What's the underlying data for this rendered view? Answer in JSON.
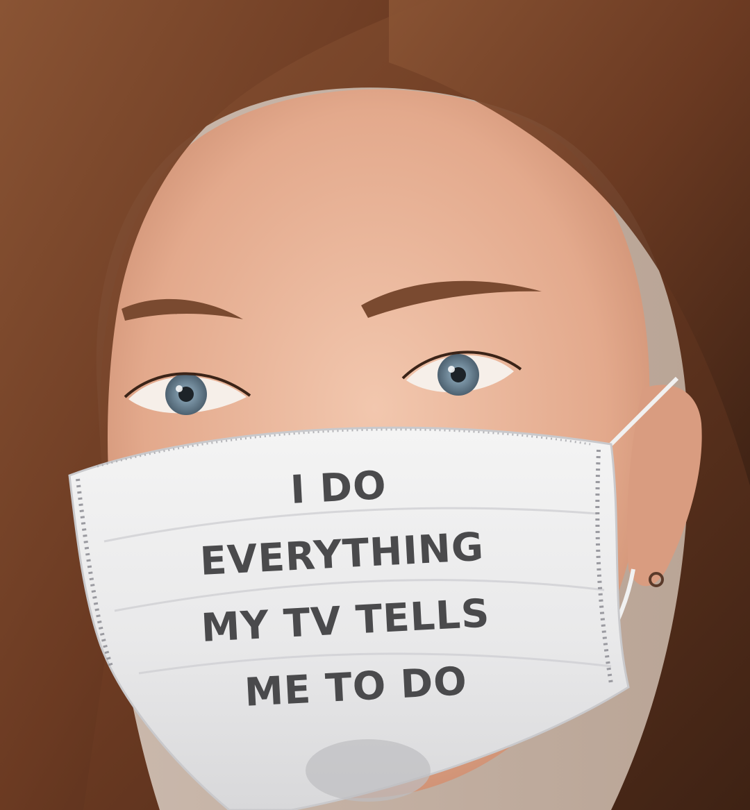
{
  "photo": {
    "subject": "woman-wearing-printed-face-mask",
    "colors": {
      "hair": "#6b3a22",
      "skin": "#e8b49a",
      "mask": "#eeeeee",
      "print": "#4a4a4c",
      "iris": "#7d97a8"
    }
  },
  "mask_text": {
    "lines": [
      "I DO",
      "EVERYTHING",
      "MY TV TELLS",
      "ME TO DO"
    ]
  }
}
